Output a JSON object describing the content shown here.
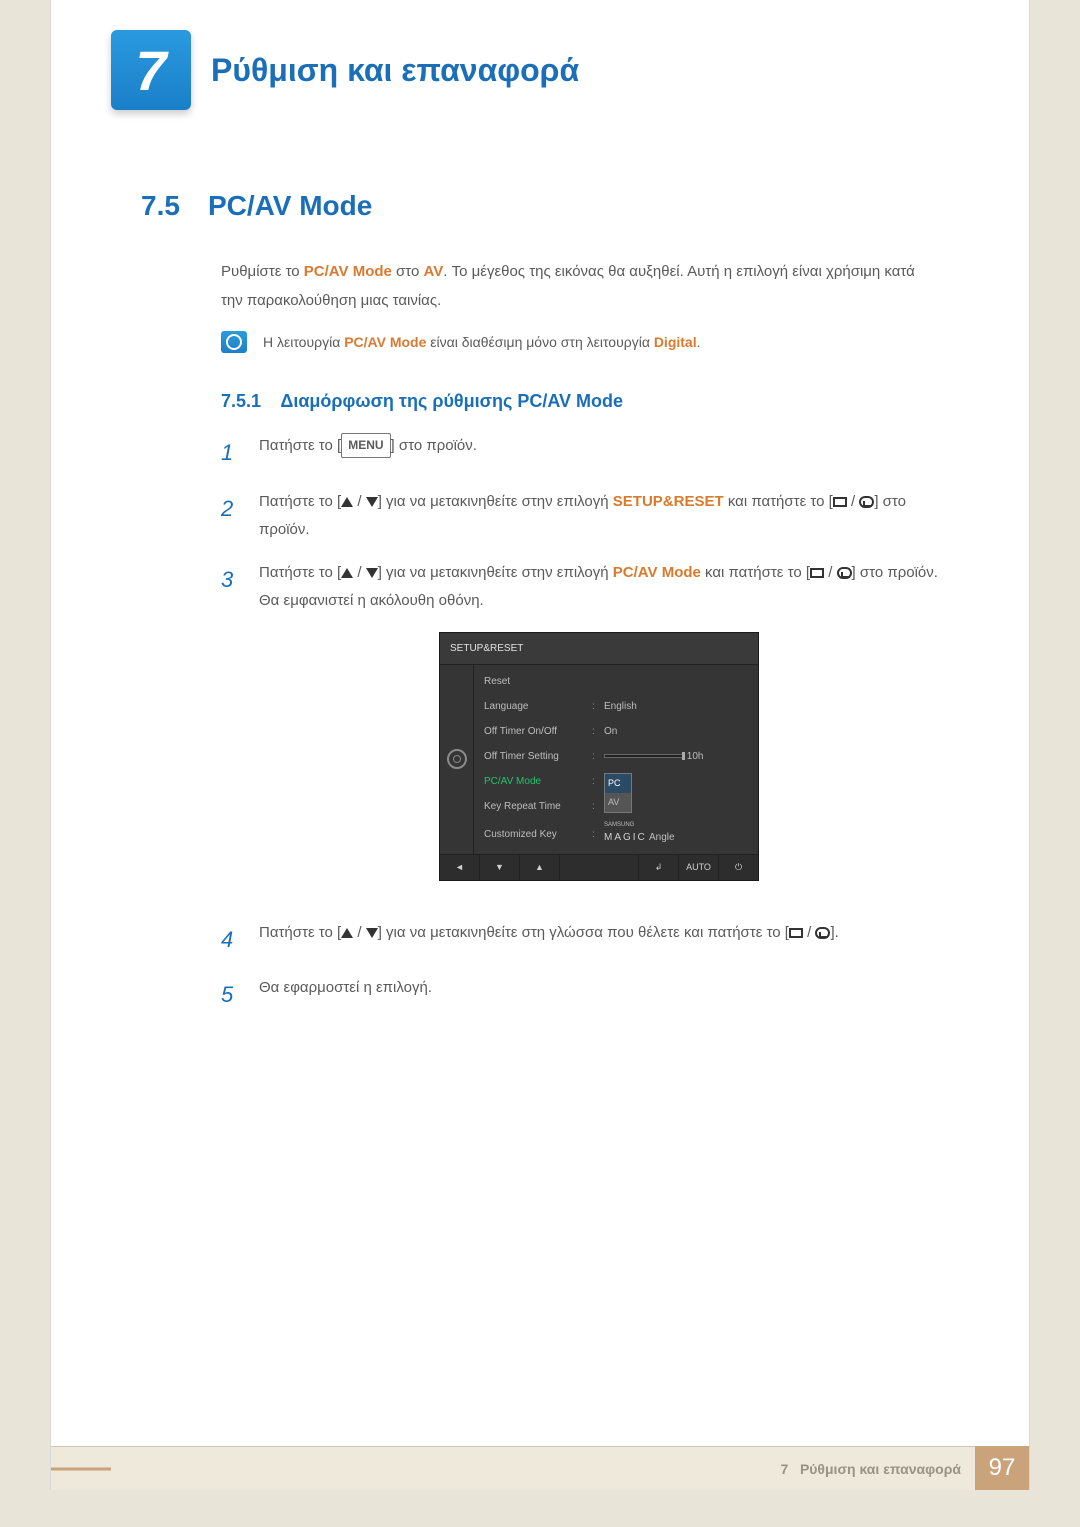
{
  "header": {
    "chapter_number": "7",
    "chapter_title": "Ρύθμιση και επαναφορά"
  },
  "section": {
    "number": "7.5",
    "title": "PC/AV Mode",
    "intro_prefix": "Ρυθμίστε το ",
    "intro_hl1": "PC/AV Mode",
    "intro_mid": " στο ",
    "intro_hl2": "AV",
    "intro_suffix": ". Το μέγεθος της εικόνας θα αυξηθεί. Αυτή η επιλογή είναι χρήσιμη κατά την παρακολούθηση μιας ταινίας.",
    "note_prefix": "Η λειτουργία ",
    "note_hl1": "PC/AV Mode",
    "note_mid": " είναι διαθέσιμη μόνο στη λειτουργία ",
    "note_hl2": "Digital",
    "note_suffix": "."
  },
  "subsection": {
    "number": "7.5.1",
    "title": "Διαμόρφωση της ρύθμισης PC/AV Mode"
  },
  "steps": {
    "s1_a": "Πατήστε το [",
    "s1_btn": "MENU",
    "s1_b": "] στο προϊόν.",
    "s2_a": "Πατήστε το [",
    "s2_b": "] για να μετακινηθείτε στην επιλογή ",
    "s2_hl": "SETUP&RESET",
    "s2_c": " και πατήστε το [",
    "s2_d": "] στο προϊόν.",
    "s3_a": "Πατήστε το [",
    "s3_b": "] για να μετακινηθείτε στην επιλογή ",
    "s3_hl": "PC/AV Mode",
    "s3_c": " και πατήστε το [",
    "s3_d": "] στο προϊόν. Θα εμφανιστεί η ακόλουθη οθόνη.",
    "s4_a": "Πατήστε το [",
    "s4_b": "] για να μετακινηθείτε στη γλώσσα που θέλετε και πατήστε το [",
    "s4_c": "].",
    "s5": "Θα εφαρμοστεί η επιλογή."
  },
  "osd": {
    "title": "SETUP&RESET",
    "rows": {
      "reset": "Reset",
      "language": "Language",
      "language_val": "English",
      "offtimer": "Off Timer On/Off",
      "offtimer_val": "On",
      "offtimer_setting": "Off Timer Setting",
      "offtimer_setting_val": "10h",
      "pcav": "PC/AV Mode",
      "pcav_opt1": "PC",
      "pcav_opt2": "AV",
      "keyrepeat": "Key Repeat Time",
      "customkey": "Customized Key",
      "customkey_brand": "SAMSUNG",
      "customkey_magic": "MAGIC",
      "customkey_suffix": " Angle"
    },
    "footer": {
      "b1": "◄",
      "b2": "▼",
      "b3": "▲",
      "b4": "↲",
      "b5": "AUTO",
      "b6": "⏻"
    }
  },
  "footer": {
    "chapter_ref_num": "7",
    "chapter_ref_title": "Ρύθμιση και επαναφορά",
    "page_number": "97"
  }
}
